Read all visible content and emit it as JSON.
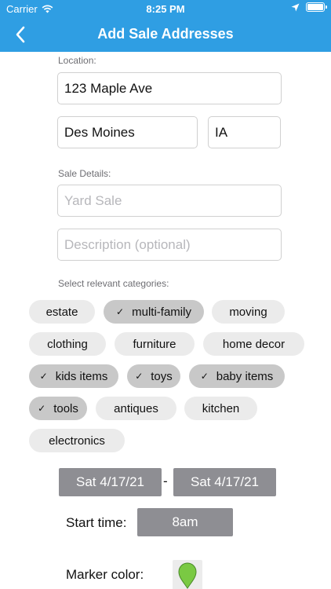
{
  "status_bar": {
    "carrier": "Carrier",
    "time": "8:25 PM",
    "wifi_icon": "wifi-icon",
    "location_icon": "location-arrow-icon",
    "battery_icon": "battery-icon"
  },
  "nav": {
    "title": "Add Sale Addresses",
    "back_icon": "chevron-left-icon"
  },
  "location": {
    "label": "Location:",
    "street": "123 Maple Ave",
    "city": "Des Moines",
    "state": "IA"
  },
  "sale_details": {
    "label": "Sale Details:",
    "type_placeholder": "Yard Sale",
    "description_placeholder": "Description (optional)"
  },
  "categories": {
    "label": "Select relevant categories:",
    "items": [
      {
        "label": "estate",
        "selected": false
      },
      {
        "label": "multi-family",
        "selected": true
      },
      {
        "label": "moving",
        "selected": false
      },
      {
        "label": "clothing",
        "selected": false
      },
      {
        "label": "furniture",
        "selected": false
      },
      {
        "label": "home decor",
        "selected": false
      },
      {
        "label": "kids items",
        "selected": true
      },
      {
        "label": "toys",
        "selected": true
      },
      {
        "label": "baby items",
        "selected": true
      },
      {
        "label": "tools",
        "selected": true
      },
      {
        "label": "antiques",
        "selected": false
      },
      {
        "label": "kitchen",
        "selected": false
      },
      {
        "label": "electronics",
        "selected": false
      }
    ]
  },
  "dates": {
    "start": "Sat 4/17/21",
    "separator": "-",
    "end": "Sat 4/17/21"
  },
  "start_time": {
    "label": "Start time:",
    "value": "8am"
  },
  "marker": {
    "label": "Marker color:",
    "color": "#7ac943",
    "icon": "map-pin-icon"
  }
}
